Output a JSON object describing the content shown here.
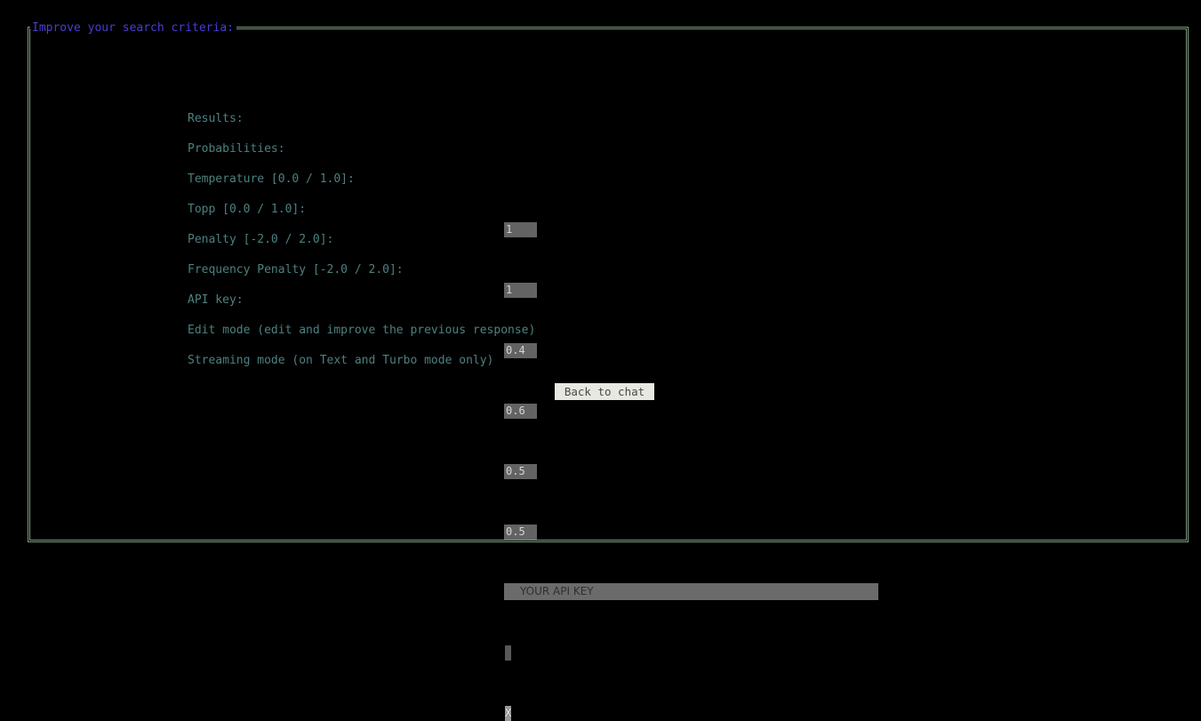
{
  "window": {
    "title": "Improve your search criteria:",
    "background_color": "#000000",
    "border_color": "#7e9e82",
    "title_color": "#4b3cd6",
    "label_color": "#4d8080",
    "field_bg_color": "#636363"
  },
  "form": {
    "fields": [
      {
        "id": "results",
        "label": "Results:",
        "value": "1",
        "type": "number"
      },
      {
        "id": "probabilities",
        "label": "Probabilities:",
        "value": "1",
        "type": "number"
      },
      {
        "id": "temperature",
        "label": "Temperature [0.0 / 1.0]:",
        "value": "0.4",
        "type": "number"
      },
      {
        "id": "topp",
        "label": "Topp [0.0 / 1.0]:",
        "value": "0.6",
        "type": "number"
      },
      {
        "id": "penalty",
        "label": "Penalty [-2.0 / 2.0]:",
        "value": "0.5",
        "type": "number"
      },
      {
        "id": "frequency-penalty",
        "label": "Frequency Penalty [-2.0 / 2.0]:",
        "value": "0.5",
        "type": "number"
      }
    ],
    "api_key": {
      "label": "API key:",
      "value": "",
      "placeholder": "YOUR API KEY"
    },
    "edit_mode": {
      "label": "Edit mode (edit and improve the previous response)",
      "checked": false,
      "mark": ""
    },
    "streaming_mode": {
      "label": "Streaming mode (on Text and Turbo mode only)",
      "checked": true,
      "mark": "X"
    },
    "submit": {
      "label": "Back to chat"
    }
  }
}
